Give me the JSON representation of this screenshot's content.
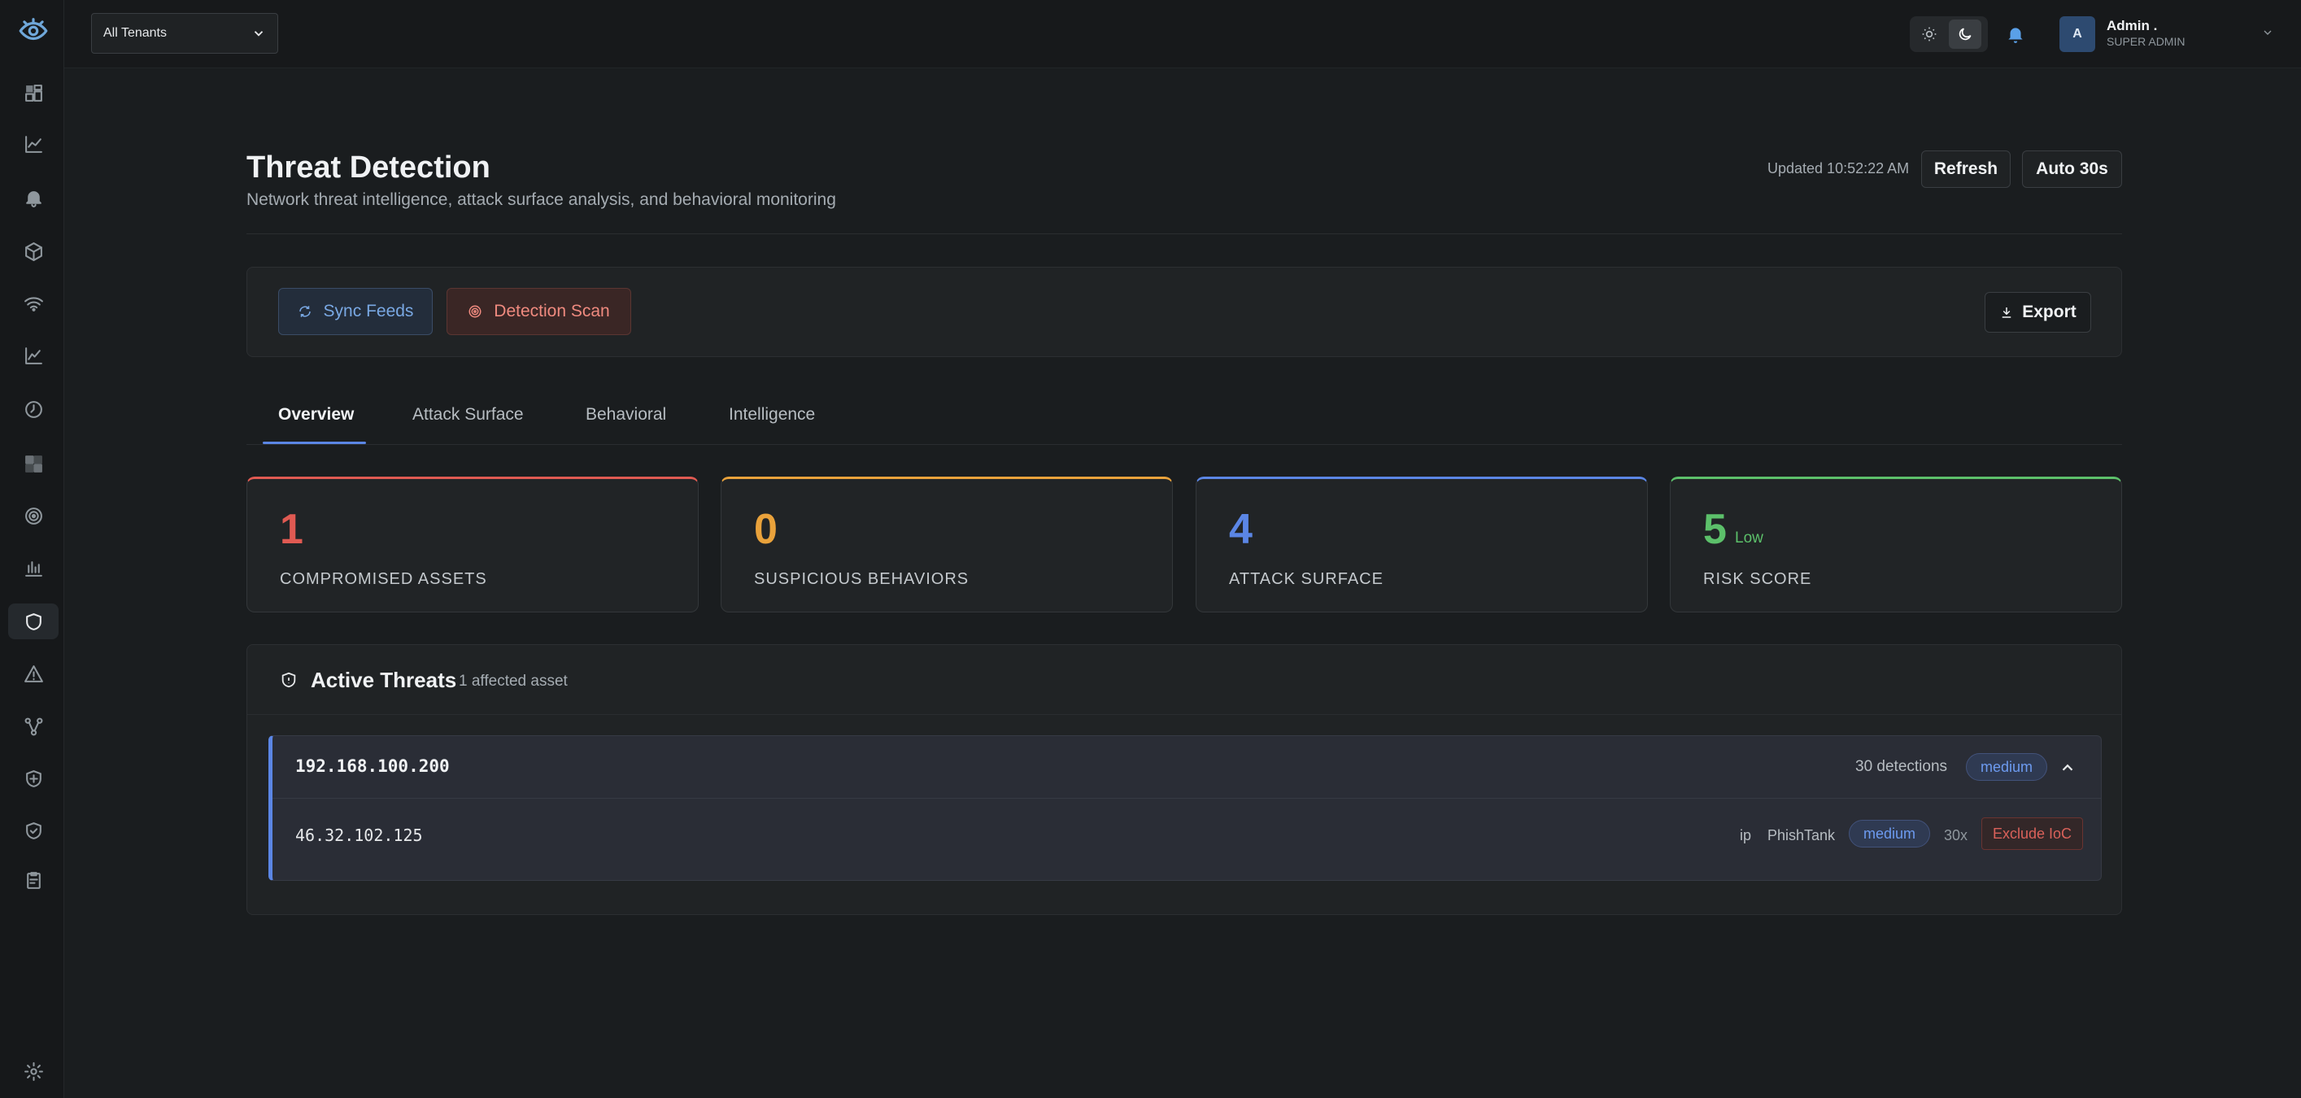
{
  "topbar": {
    "tenant_select": "All Tenants",
    "user": {
      "avatar_initial": "A",
      "name": "Admin .",
      "role": "SUPER ADMIN"
    }
  },
  "sidebar": {
    "items": [
      "dashboard",
      "analytics",
      "alerts",
      "assets",
      "network",
      "trends",
      "history",
      "apps",
      "detection-radar",
      "reports",
      "threat-detection",
      "warnings",
      "topology",
      "security-policy",
      "compliance",
      "audit",
      "settings"
    ],
    "active": "threat-detection"
  },
  "header": {
    "title": "Threat Detection",
    "subtitle": "Network threat intelligence, attack surface analysis, and behavioral monitoring",
    "updated": "Updated 10:52:22 AM",
    "refresh_label": "Refresh",
    "auto_label": "Auto 30s"
  },
  "actions": {
    "sync_label": "Sync Feeds",
    "scan_label": "Detection Scan",
    "export_label": "Export"
  },
  "tabs": [
    "Overview",
    "Attack Surface",
    "Behavioral",
    "Intelligence"
  ],
  "active_tab": "Overview",
  "stats": [
    {
      "value": "1",
      "label": "COMPROMISED ASSETS",
      "color": "#e05a52"
    },
    {
      "value": "0",
      "label": "SUSPICIOUS BEHAVIORS",
      "color": "#e9a23b"
    },
    {
      "value": "4",
      "label": "ATTACK SURFACE",
      "color": "#5b86e5"
    },
    {
      "value": "5",
      "sub": "Low",
      "label": "RISK SCORE",
      "color": "#5cc06a"
    }
  ],
  "threats": {
    "title": "Active Threats",
    "count": "1 affected asset",
    "assets": [
      {
        "ip": "192.168.100.200",
        "detections": "30 detections",
        "severity": "medium",
        "iocs": [
          {
            "ip": "46.32.102.125",
            "type": "ip",
            "source": "PhishTank",
            "severity": "medium",
            "hits": "30x",
            "action": "Exclude IoC"
          }
        ]
      }
    ]
  },
  "colors": {
    "accent": "#5b86e5",
    "danger": "#e05a52",
    "warning": "#e9a23b",
    "success": "#5cc06a"
  }
}
